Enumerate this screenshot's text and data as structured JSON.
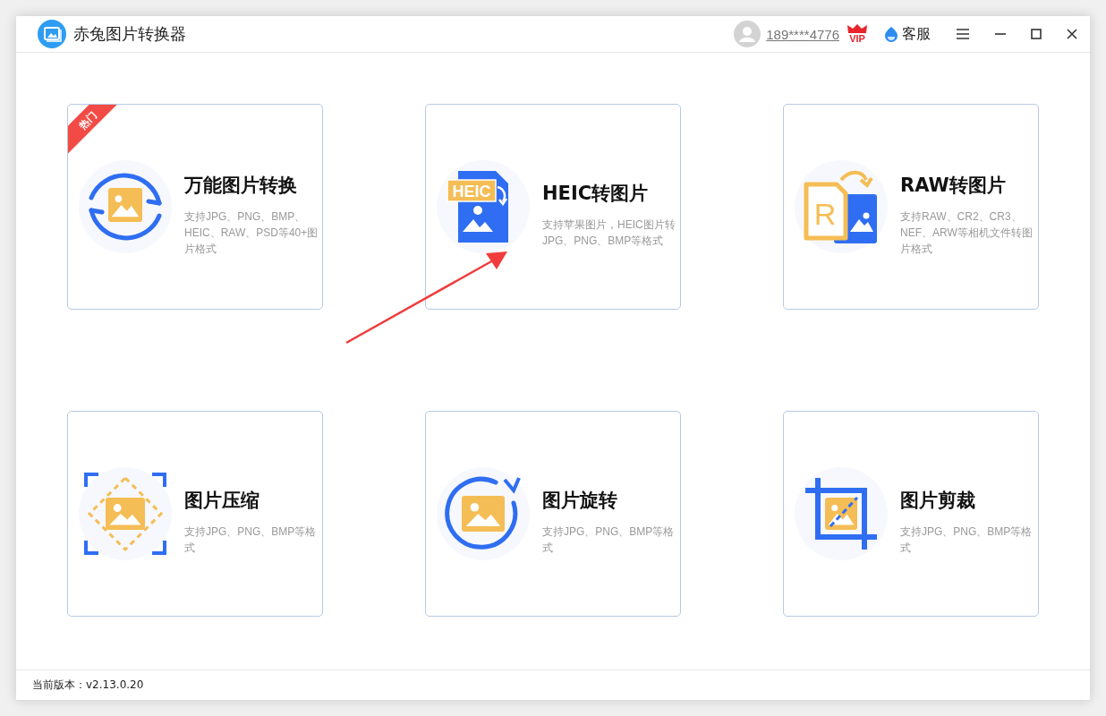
{
  "window": {
    "title": "赤兔图片转换器"
  },
  "account": {
    "phone": "189****4776",
    "vip_badge": "VIP",
    "support": "客服"
  },
  "tools": [
    {
      "kind": "convert",
      "title": "万能图片转换",
      "description": "支持JPG、PNG、BMP、HEIC、RAW、PSD等40+图片格式",
      "badge": "热门"
    },
    {
      "kind": "heic",
      "title": "HEIC转图片",
      "description": "支持苹果图片，HEIC图片转JPG、PNG、BMP等格式",
      "icon_label": "HEIC"
    },
    {
      "kind": "raw",
      "title": "RAW转图片",
      "description": "支持RAW、CR2、CR3、NEF、ARW等相机文件转图片格式",
      "icon_label": "R"
    },
    {
      "kind": "compress",
      "title": "图片压缩",
      "description": "支持JPG、PNG、BMP等格式"
    },
    {
      "kind": "rotate",
      "title": "图片旋转",
      "description": "支持JPG、PNG、BMP等格式"
    },
    {
      "kind": "crop",
      "title": "图片剪裁",
      "description": "支持JPG、PNG、BMP等格式"
    }
  ],
  "status_bar": {
    "version": "当前版本：v2.13.0.20"
  }
}
